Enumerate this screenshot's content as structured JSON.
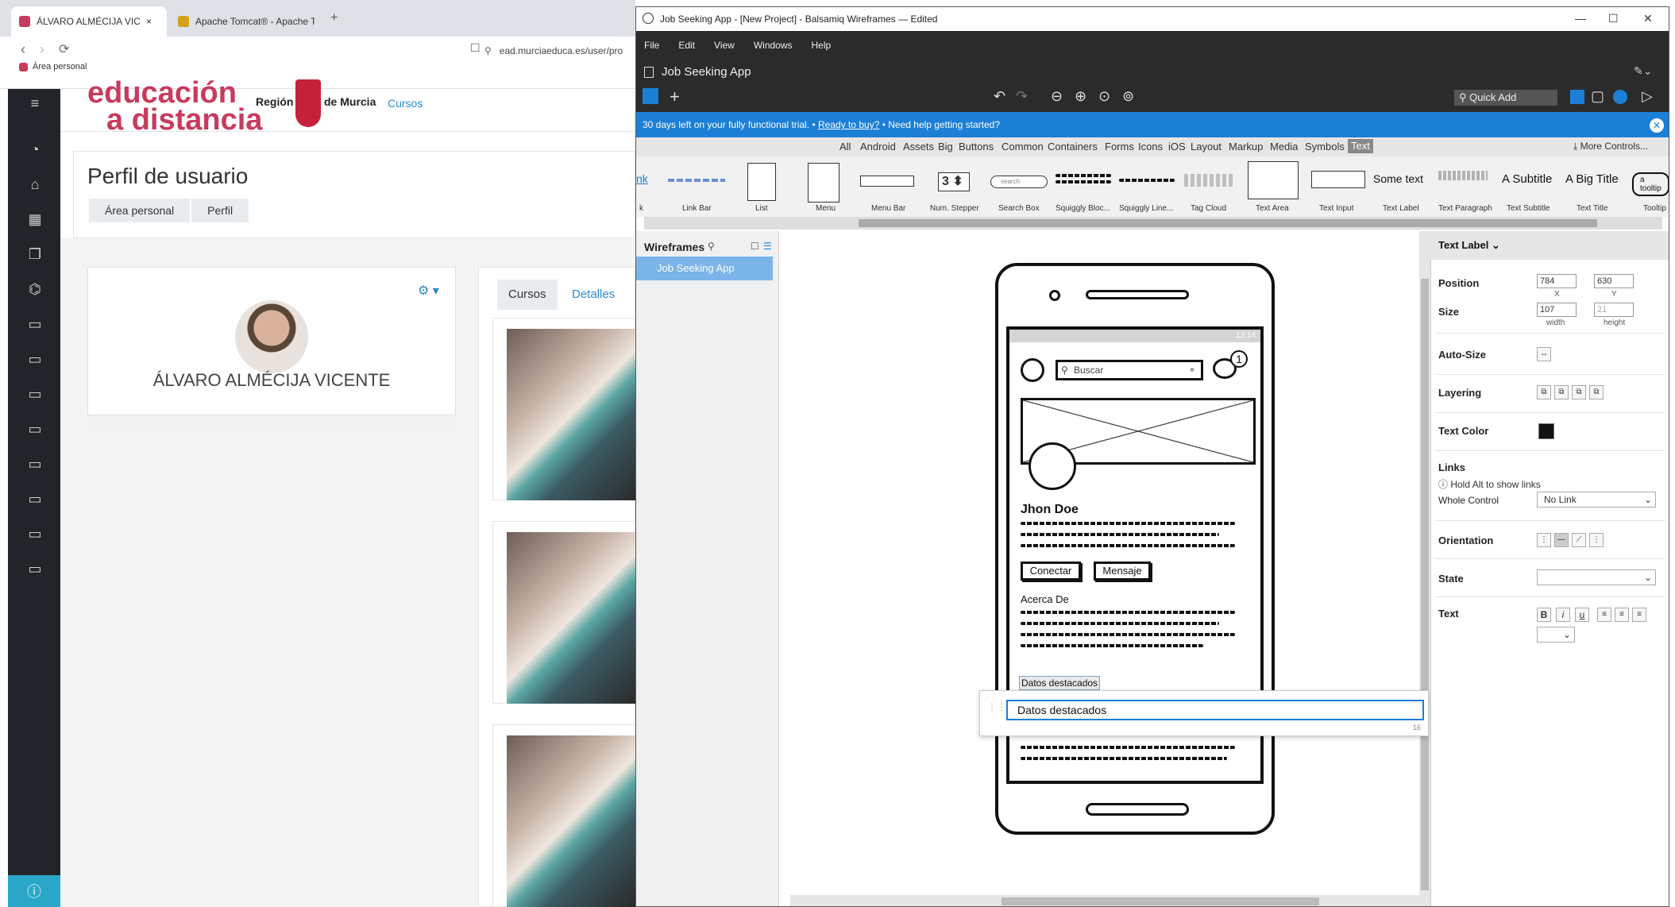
{
  "browser": {
    "tabs": [
      {
        "label": "ÁLVARO ALMÉCIJA VICENTE: Pe"
      },
      {
        "label": "Apache Tomcat® - Apache Tomcat"
      }
    ],
    "new_tab": "+",
    "close_glyph": "×",
    "url": "ead.murciaeduca.es/user/pro",
    "bookmark": "Área personal"
  },
  "moodle": {
    "logo_line1": "educación",
    "logo_line2": "a distancia",
    "region": "Región",
    "de_murcia": "de Murcia",
    "nav_cursos": "Cursos",
    "page_title": "Perfil de usuario",
    "breadcrumbs": [
      "Área personal",
      "Perfil"
    ],
    "user_name": "ÁLVARO ALMÉCIJA VICENTE",
    "course_tabs": [
      "Cursos",
      "Detalles"
    ],
    "side_icons": [
      "menu-icon",
      "dashboard-icon",
      "home-icon",
      "calendar-icon",
      "files-icon",
      "graduation-icon",
      "folder-icon",
      "folder-icon",
      "folder-icon",
      "folder-icon",
      "folder-icon",
      "folder-icon",
      "folder-icon",
      "folder-icon"
    ]
  },
  "balsamiq": {
    "window_title": "Job Seeking App - [New Project] - Balsamiq Wireframes — Edited",
    "menu": [
      "File",
      "Edit",
      "View",
      "Windows",
      "Help"
    ],
    "project_name": "Job Seeking App",
    "quick_add": "Quick Add",
    "trial": {
      "text": "30 days left on your fully functional trial.",
      "ready": "Ready to buy?",
      "help": "Need help getting started?"
    },
    "categories": [
      "All",
      "Android",
      "Assets",
      "Big",
      "Buttons",
      "Common",
      "Containers",
      "Forms",
      "Icons",
      "iOS",
      "Layout",
      "Markup",
      "Media",
      "Symbols",
      "Text"
    ],
    "more_controls": "More Controls...",
    "gallery": [
      {
        "label": "Link Bar"
      },
      {
        "label": "List"
      },
      {
        "label": "Menu"
      },
      {
        "label": "Menu Bar"
      },
      {
        "label": "Num. Stepper"
      },
      {
        "label": "Search Box"
      },
      {
        "label": "Squiggly Bloc..."
      },
      {
        "label": "Squiggly Line..."
      },
      {
        "label": "Tag Cloud"
      },
      {
        "label": "Text Area"
      },
      {
        "label": "Text Input"
      },
      {
        "label": "Text Label"
      },
      {
        "label": "Text Paragraph"
      },
      {
        "label": "Text Subtitle"
      },
      {
        "label": "Text Title"
      },
      {
        "label": "Tooltip"
      }
    ],
    "gallery_samples": {
      "stepper": "3",
      "some_text": "Some text",
      "subtitle": "A Subtitle",
      "big_title": "A Big Title",
      "tooltip": "a tooltip",
      "search": "search",
      "link_fragment": "nk"
    },
    "wireframes_header": "Wireframes",
    "wireframe_item": "Job Seeking App",
    "mockup": {
      "status_time": "13:14",
      "search": "Buscar",
      "badge": "1",
      "name": "Jhon Doe",
      "btn_connect": "Conectar",
      "btn_message": "Mensaje",
      "about": "Acerca De",
      "highlighted": "Datos destacados"
    },
    "editor": {
      "value": "Datos destacados",
      "count": "16"
    },
    "inspector": {
      "title": "Text Label",
      "position_label": "Position",
      "x": "784",
      "y": "630",
      "x_sub": "X",
      "y_sub": "Y",
      "size_label": "Size",
      "width": "107",
      "height": "21",
      "width_sub": "width",
      "height_sub": "height",
      "autosize": "Auto-Size",
      "layering": "Layering",
      "text_color": "Text Color",
      "text_color_value": "#111111",
      "links": "Links",
      "links_hint": "Hold Alt to show links",
      "whole_control": "Whole Control",
      "whole_control_value": "No Link",
      "orientation": "Orientation",
      "state": "State",
      "text": "Text",
      "text_style": [
        "B",
        "i",
        "u"
      ]
    }
  }
}
